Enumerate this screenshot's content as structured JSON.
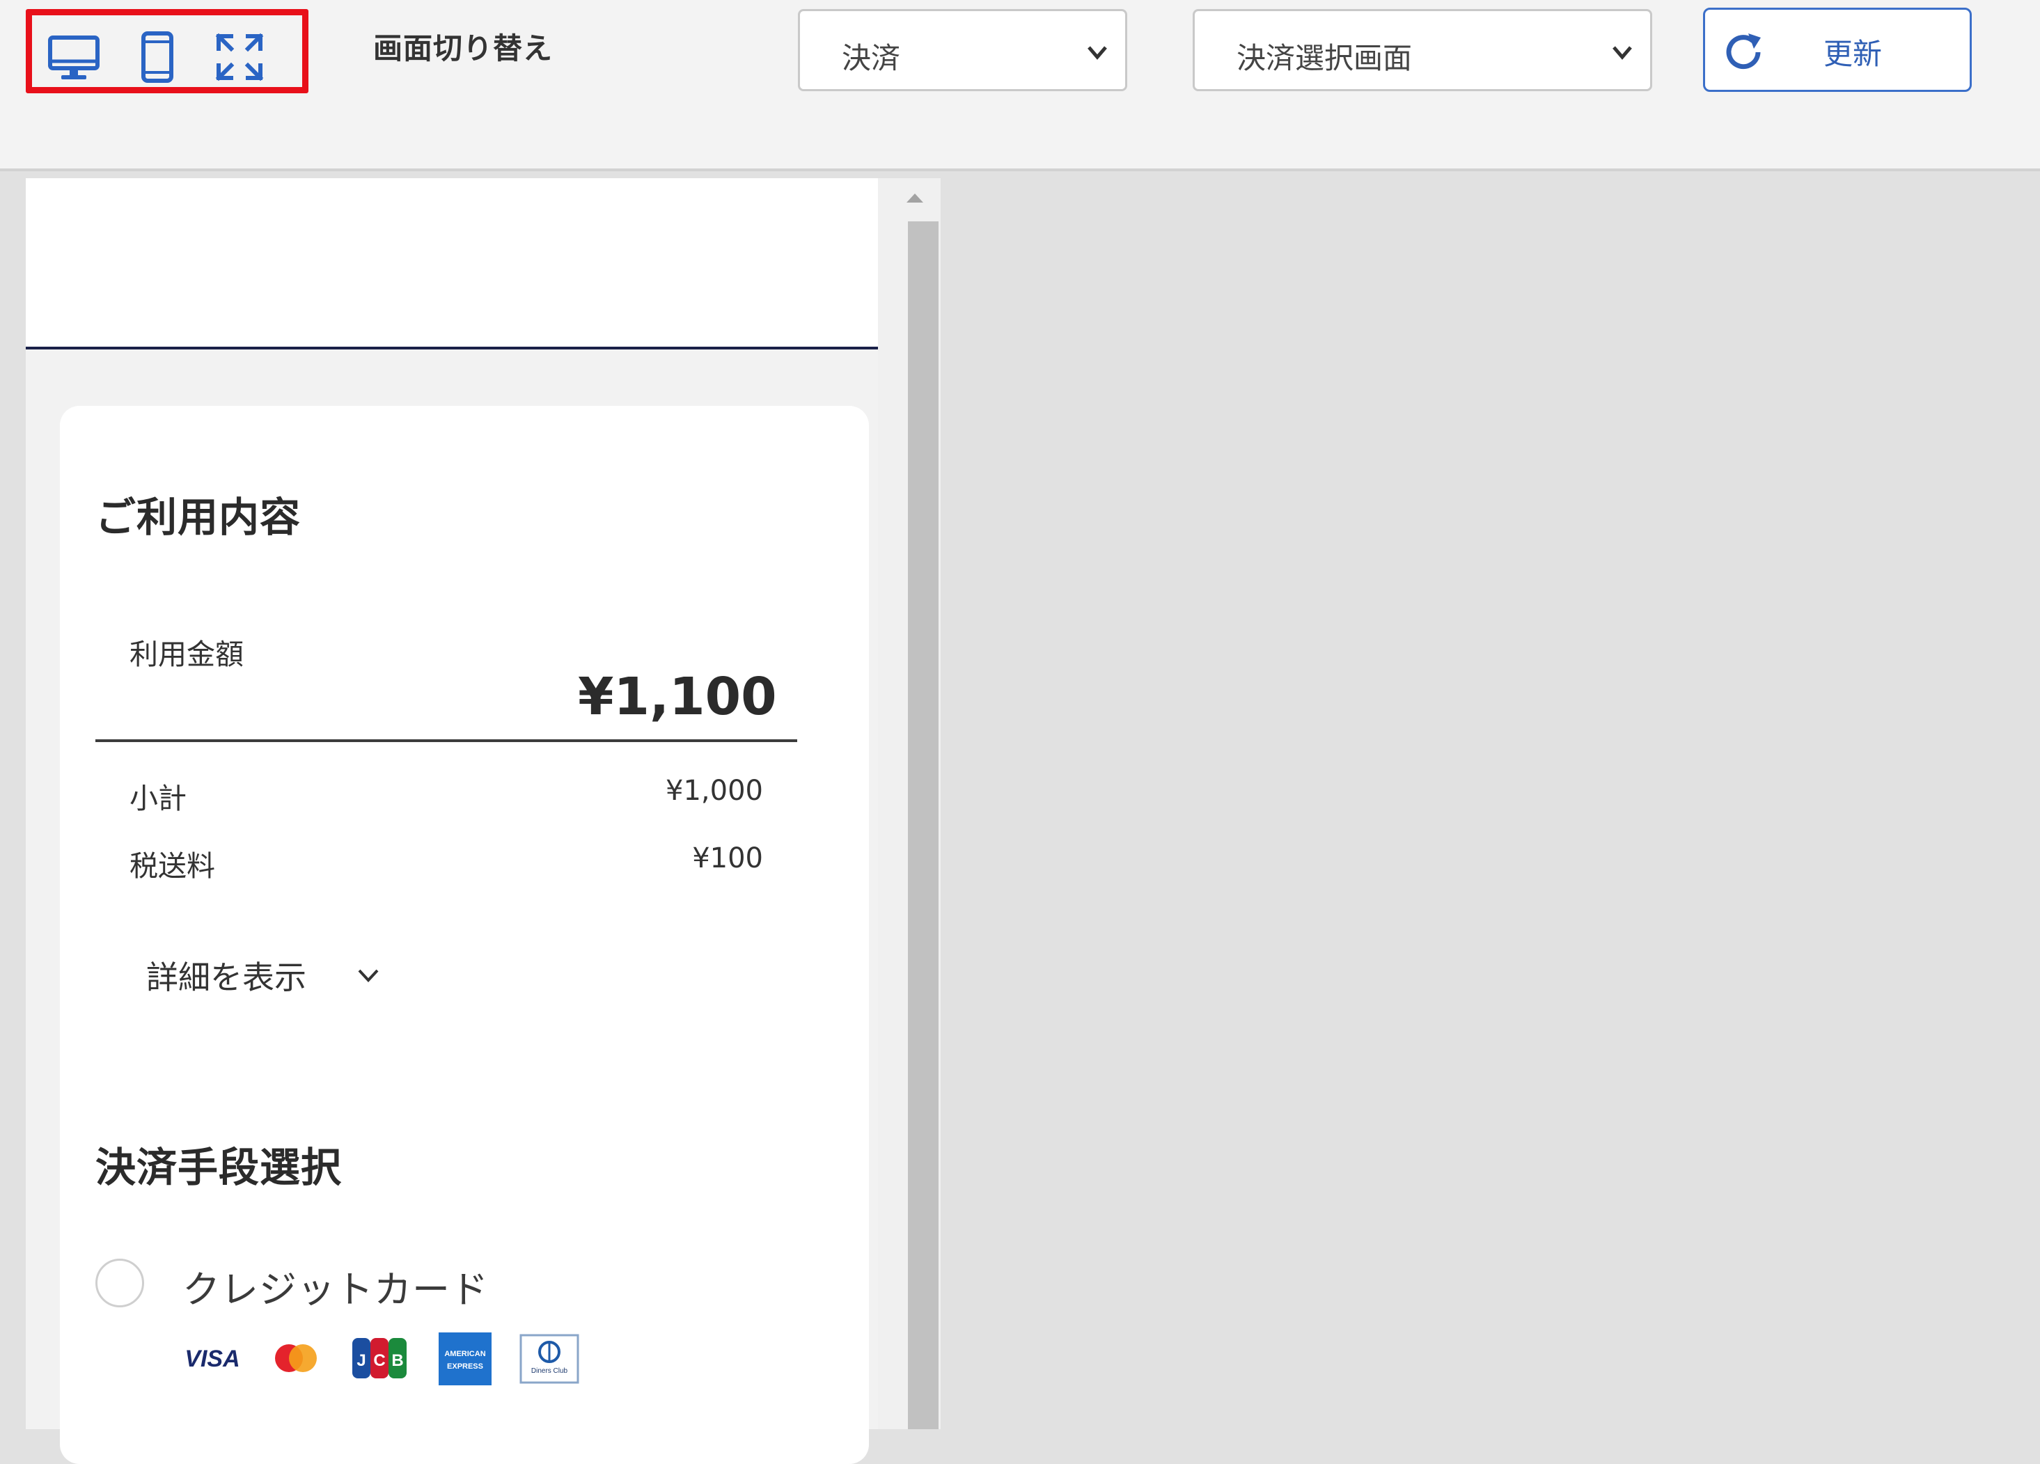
{
  "toolbar": {
    "view_switch_label": "画面切り替え",
    "view_icons": [
      "desktop-icon",
      "mobile-icon",
      "fullscreen-icon"
    ],
    "category_select": {
      "value": "決済"
    },
    "screen_select": {
      "value": "決済選択画面"
    },
    "refresh_label": "更新",
    "highlight_color": "#e8101a",
    "accent_color": "#2f5fb5"
  },
  "summary": {
    "title": "ご利用内容",
    "amount_label": "利用金額",
    "amount": "¥1,100",
    "rows": [
      {
        "label": "小計",
        "value": "¥1,000"
      },
      {
        "label": "税送料",
        "value": "¥100"
      }
    ],
    "details_toggle": "詳細を表示"
  },
  "payment": {
    "title": "決済手段選択",
    "options": [
      {
        "label": "クレジットカード",
        "selected": false
      }
    ],
    "card_brands": [
      "VISA",
      "Mastercard",
      "JCB",
      "AMERICAN EXPRESS",
      "Diners Club"
    ]
  }
}
